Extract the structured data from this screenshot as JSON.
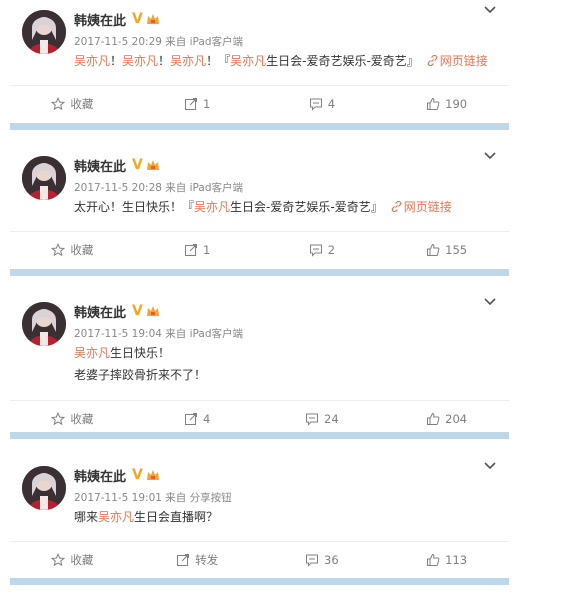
{
  "posts": [
    {
      "author": "韩姨在此",
      "verified": "V",
      "meta": "2017-11-5 20:29 来自 iPad客户端",
      "lines": [
        [
          {
            "t": "吴亦凡",
            "m": true
          },
          {
            "t": "！",
            "m": false
          },
          {
            "t": "吴亦凡",
            "m": true
          },
          {
            "t": "！",
            "m": false
          },
          {
            "t": "吴亦凡",
            "m": true
          },
          {
            "t": "！『",
            "m": false
          },
          {
            "t": "吴亦凡",
            "m": true
          },
          {
            "t": "生日会-爱奇艺娱乐-爱奇艺』",
            "m": false
          }
        ]
      ],
      "link": "网页链接",
      "actions": {
        "fav": "收藏",
        "repost": "1",
        "comment": "4",
        "like": "190"
      }
    },
    {
      "author": "韩姨在此",
      "verified": "V",
      "meta": "2017-11-5 20:28 来自 iPad客户端",
      "lines": [
        [
          {
            "t": "太开心！生日快乐！『",
            "m": false
          },
          {
            "t": "吴亦凡",
            "m": true
          },
          {
            "t": "生日会-爱奇艺娱乐-爱奇艺』",
            "m": false
          }
        ]
      ],
      "link": "网页链接",
      "actions": {
        "fav": "收藏",
        "repost": "1",
        "comment": "2",
        "like": "155"
      }
    },
    {
      "author": "韩姨在此",
      "verified": "V",
      "meta": "2017-11-5 19:04 来自 iPad客户端",
      "lines": [
        [
          {
            "t": "吴亦凡",
            "m": true
          },
          {
            "t": "生日快乐！",
            "m": false
          }
        ],
        [
          {
            "t": "老婆子摔跤骨折来不了！",
            "m": false
          }
        ]
      ],
      "link": "",
      "actions": {
        "fav": "收藏",
        "repost": "4",
        "comment": "24",
        "like": "204"
      }
    },
    {
      "author": "韩姨在此",
      "verified": "V",
      "meta": "2017-11-5 19:01 来自 分享按钮",
      "lines": [
        [
          {
            "t": "哪来",
            "m": false
          },
          {
            "t": "吴亦凡",
            "m": true
          },
          {
            "t": "生日会直播啊？",
            "m": false
          }
        ]
      ],
      "link": "",
      "actions": {
        "fav": "收藏",
        "repost": "转发",
        "comment": "36",
        "like": "113"
      }
    }
  ],
  "colors": {
    "mention": "#eb7350",
    "separator": "#bed7ea",
    "verified": "#f5a623",
    "muted": "#808080"
  },
  "icons": {
    "fav": "star-icon",
    "repost": "repost-icon",
    "comment": "comment-icon",
    "like": "thumbs-up-icon",
    "link": "link-icon",
    "menu": "chevron-down-icon",
    "vip": "crown-icon"
  }
}
